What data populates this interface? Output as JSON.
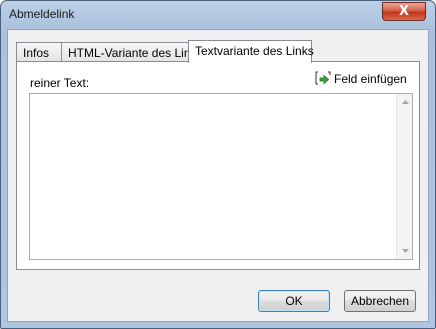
{
  "window": {
    "title": "Abmeldelink",
    "close_glyph": "X"
  },
  "tabs": [
    {
      "label": "Infos",
      "active": false
    },
    {
      "label": "HTML-Variante des Links",
      "active": false
    },
    {
      "label": "Textvariante des Links",
      "active": true
    }
  ],
  "panel": {
    "label": "reiner Text:",
    "insert_field_label": "Feld einfügen",
    "insert_field_icon": "insert-field-icon",
    "text_value": ""
  },
  "buttons": {
    "ok": "OK",
    "cancel": "Abbrechen"
  }
}
